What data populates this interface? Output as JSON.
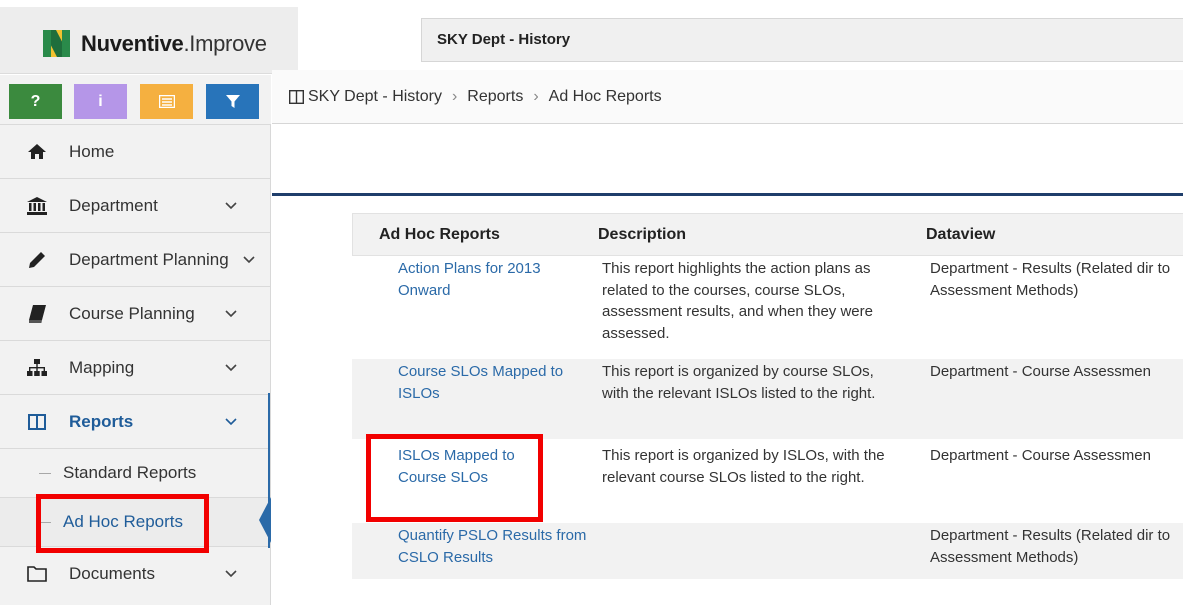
{
  "app": {
    "brand_bold": "Nuventive",
    "brand_light": ".Improve",
    "context": "SKY Dept - History"
  },
  "toolbar": {
    "help": "?",
    "info": "i"
  },
  "sidebar": {
    "items": [
      {
        "label": "Home"
      },
      {
        "label": "Department"
      },
      {
        "label": "Department Planning"
      },
      {
        "label": "Course Planning"
      },
      {
        "label": "Mapping"
      },
      {
        "label": "Reports"
      },
      {
        "label": "Documents"
      }
    ],
    "sub_items": [
      {
        "label": "Standard Reports"
      },
      {
        "label": "Ad Hoc Reports"
      }
    ]
  },
  "breadcrumb": [
    "SKY Dept - History",
    "Reports",
    "Ad Hoc Reports"
  ],
  "table": {
    "headers": [
      "Ad Hoc Reports",
      "Description",
      "Dataview"
    ],
    "rows": [
      {
        "name": "Action Plans for 2013 Onward",
        "description": "This report highlights the action plans as related to the courses, course SLOs, assessment results, and when they were assessed.",
        "dataview": "Department - Results (Related dir to Assessment Methods)"
      },
      {
        "name": "Course SLOs Mapped to ISLOs",
        "description": "This report is organized by course SLOs, with the relevant ISLOs listed to the right.",
        "dataview": "Department - Course Assessmen"
      },
      {
        "name": "ISLOs Mapped to Course SLOs",
        "description": "This report is organized by ISLOs, with the relevant course SLOs listed to the right.",
        "dataview": "Department - Course Assessmen"
      },
      {
        "name": "Quantify PSLO Results from CSLO Results",
        "description": "",
        "dataview": "Department - Results (Related dir to Assessment Methods)"
      }
    ]
  },
  "colors": {
    "link": "#2b6aa8",
    "highlight": "#f20000",
    "help_btn": "#3b8a3e",
    "info_btn": "#b596e8",
    "note_btn": "#f5b040",
    "filter_btn": "#2874ba"
  }
}
